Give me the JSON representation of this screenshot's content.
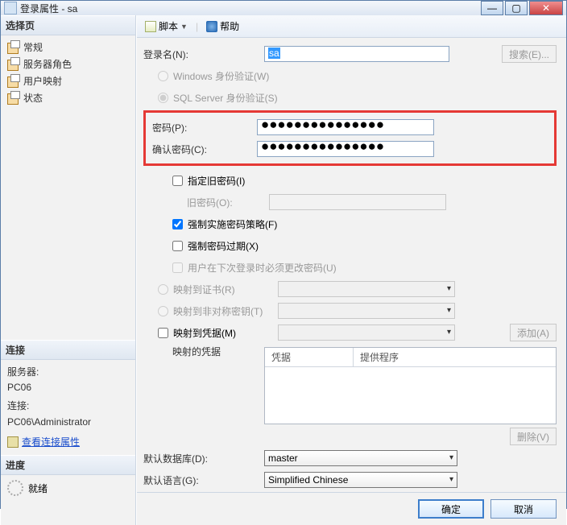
{
  "window": {
    "title": "登录属性 - sa"
  },
  "sidebar": {
    "select_header": "选择页",
    "items": [
      "常规",
      "服务器角色",
      "用户映射",
      "状态"
    ],
    "conn_header": "连接",
    "server_label": "服务器:",
    "server_value": "PC06",
    "conn_label": "连接:",
    "conn_value": "PC06\\Administrator",
    "view_conn_link": "查看连接属性",
    "progress_header": "进度",
    "status": "就绪"
  },
  "toolbar": {
    "script": "脚本",
    "help": "帮助"
  },
  "form": {
    "login_label": "登录名(N):",
    "login_value": "sa",
    "search_btn": "搜索(E)...",
    "auth_win": "Windows 身份验证(W)",
    "auth_sql": "SQL Server 身份验证(S)",
    "pwd_label": "密码(P):",
    "pwd_value": "●●●●●●●●●●●●●●●",
    "confirm_label": "确认密码(C):",
    "confirm_value": "●●●●●●●●●●●●●●●",
    "oldpwd_chk": "指定旧密码(I)",
    "oldpwd_label": "旧密码(O):",
    "policy_chk": "强制实施密码策略(F)",
    "expire_chk": "强制密码过期(X)",
    "mustchg_chk": "用户在下次登录时必须更改密码(U)",
    "map_cert": "映射到证书(R)",
    "map_key": "映射到非对称密钥(T)",
    "map_cred": "映射到凭据(M)",
    "add_btn": "添加(A)",
    "cred_label": "映射的凭据",
    "cred_col1": "凭据",
    "cred_col2": "提供程序",
    "del_btn": "删除(V)",
    "defdb_label": "默认数据库(D):",
    "defdb_value": "master",
    "deflang_label": "默认语言(G):",
    "deflang_value": "Simplified Chinese"
  },
  "footer": {
    "ok": "确定",
    "cancel": "取消"
  }
}
